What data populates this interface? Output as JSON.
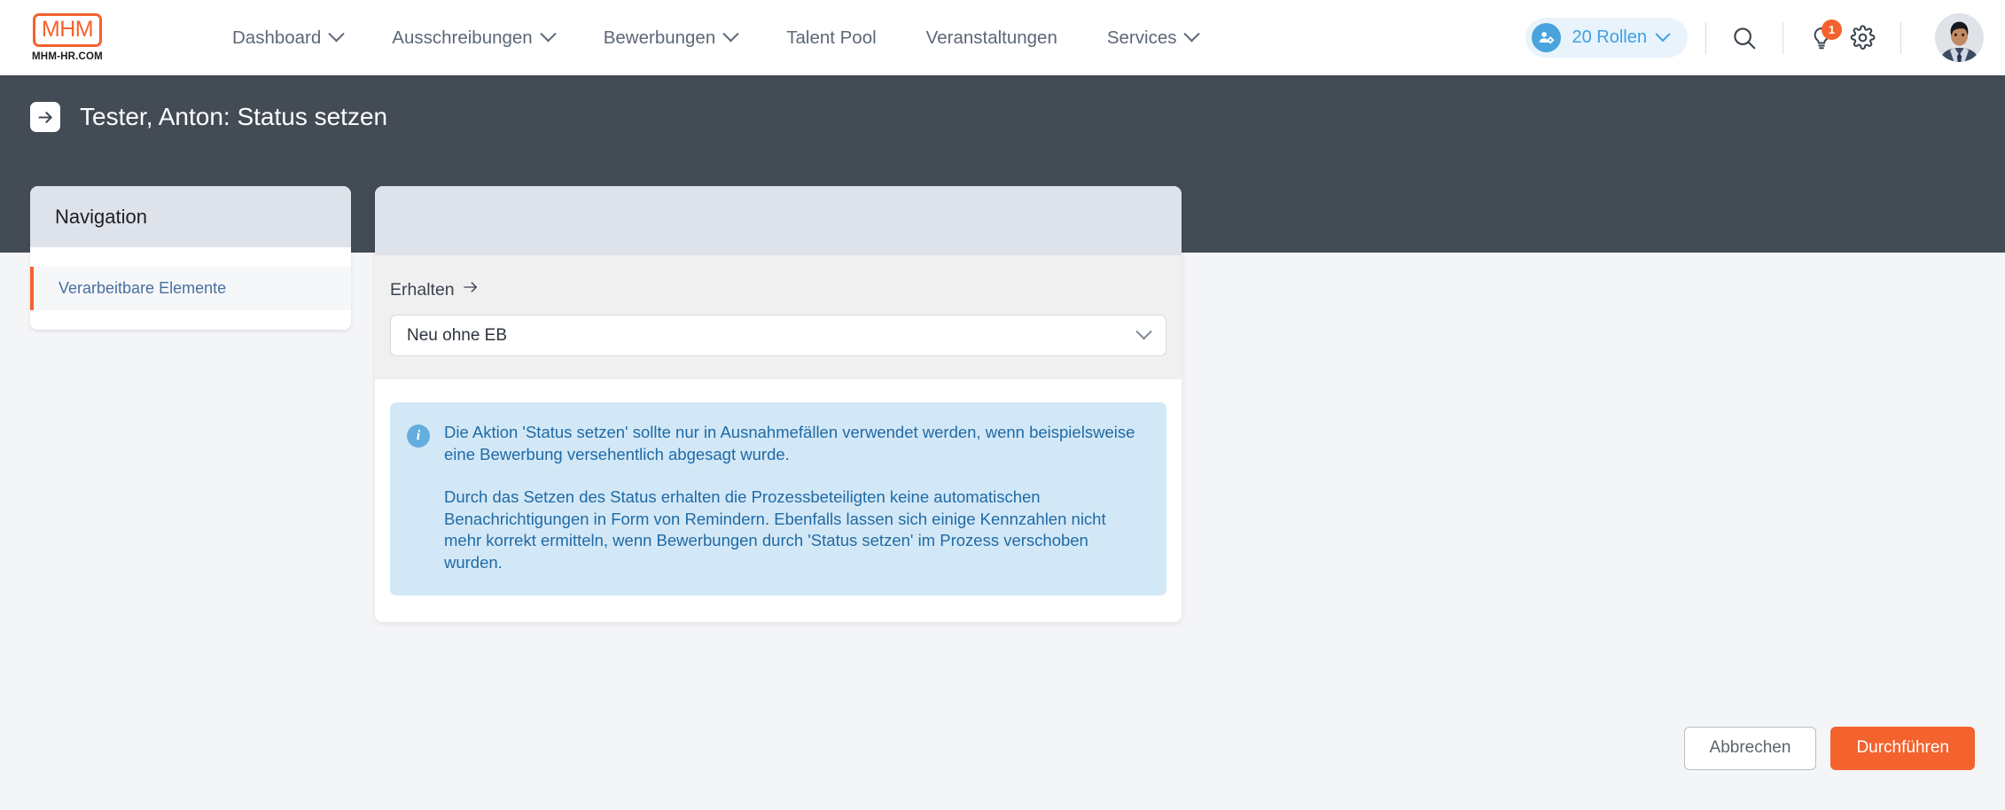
{
  "brand": {
    "logo_text": "MHM",
    "logo_subtitle": "MHM-HR.COM",
    "accent_color": "#f4622d"
  },
  "topnav": {
    "items": [
      {
        "label": "Dashboard",
        "has_chevron": true
      },
      {
        "label": "Ausschreibungen",
        "has_chevron": true
      },
      {
        "label": "Bewerbungen",
        "has_chevron": true
      },
      {
        "label": "Talent Pool",
        "has_chevron": false
      },
      {
        "label": "Veranstaltungen",
        "has_chevron": false
      },
      {
        "label": "Services",
        "has_chevron": true
      }
    ],
    "roles_badge": {
      "label": "20 Rollen",
      "icon": "user-roles-icon",
      "chevron": "chevron-down-icon",
      "color": "#3fa0e0",
      "background": "#e8f3fc"
    },
    "icons": [
      {
        "name": "search-icon"
      },
      {
        "name": "lightbulb-icon",
        "badge_count": "1",
        "badge_color": "#f4622d"
      },
      {
        "name": "gear-icon"
      }
    ],
    "avatar": {
      "name": "user-avatar"
    }
  },
  "page_header": {
    "icon": "arrow-right-icon",
    "title": "Tester, Anton: Status setzen",
    "background": "#434b55"
  },
  "sidebar": {
    "heading": "Navigation",
    "items": [
      {
        "label": "Verarbeitbare Elemente",
        "active": true
      }
    ]
  },
  "main": {
    "field": {
      "label": "Erhalten",
      "label_arrow": "→",
      "select_value": "Neu ohne EB",
      "select_chevron": "chevron-down-icon"
    },
    "infobox": {
      "icon": "info-icon",
      "paragraphs": [
        "Die Aktion 'Status setzen' sollte nur in Ausnahmefällen verwendet werden, wenn beispielsweise eine Bewerbung versehentlich abgesagt wurde.",
        "Durch das Setzen des Status erhalten die Prozessbeteiligten keine automatischen Benachrichtigungen in Form von Remindern. Ebenfalls lassen sich einige Kennzahlen nicht mehr korrekt ermitteln, wenn Bewerbungen durch 'Status setzen' im Prozess verschoben wurden."
      ],
      "background": "#d3e8f7",
      "text_color": "#1f6aa5"
    }
  },
  "footer": {
    "cancel_label": "Abbrechen",
    "submit_label": "Durchführen",
    "submit_color": "#f4622d"
  }
}
